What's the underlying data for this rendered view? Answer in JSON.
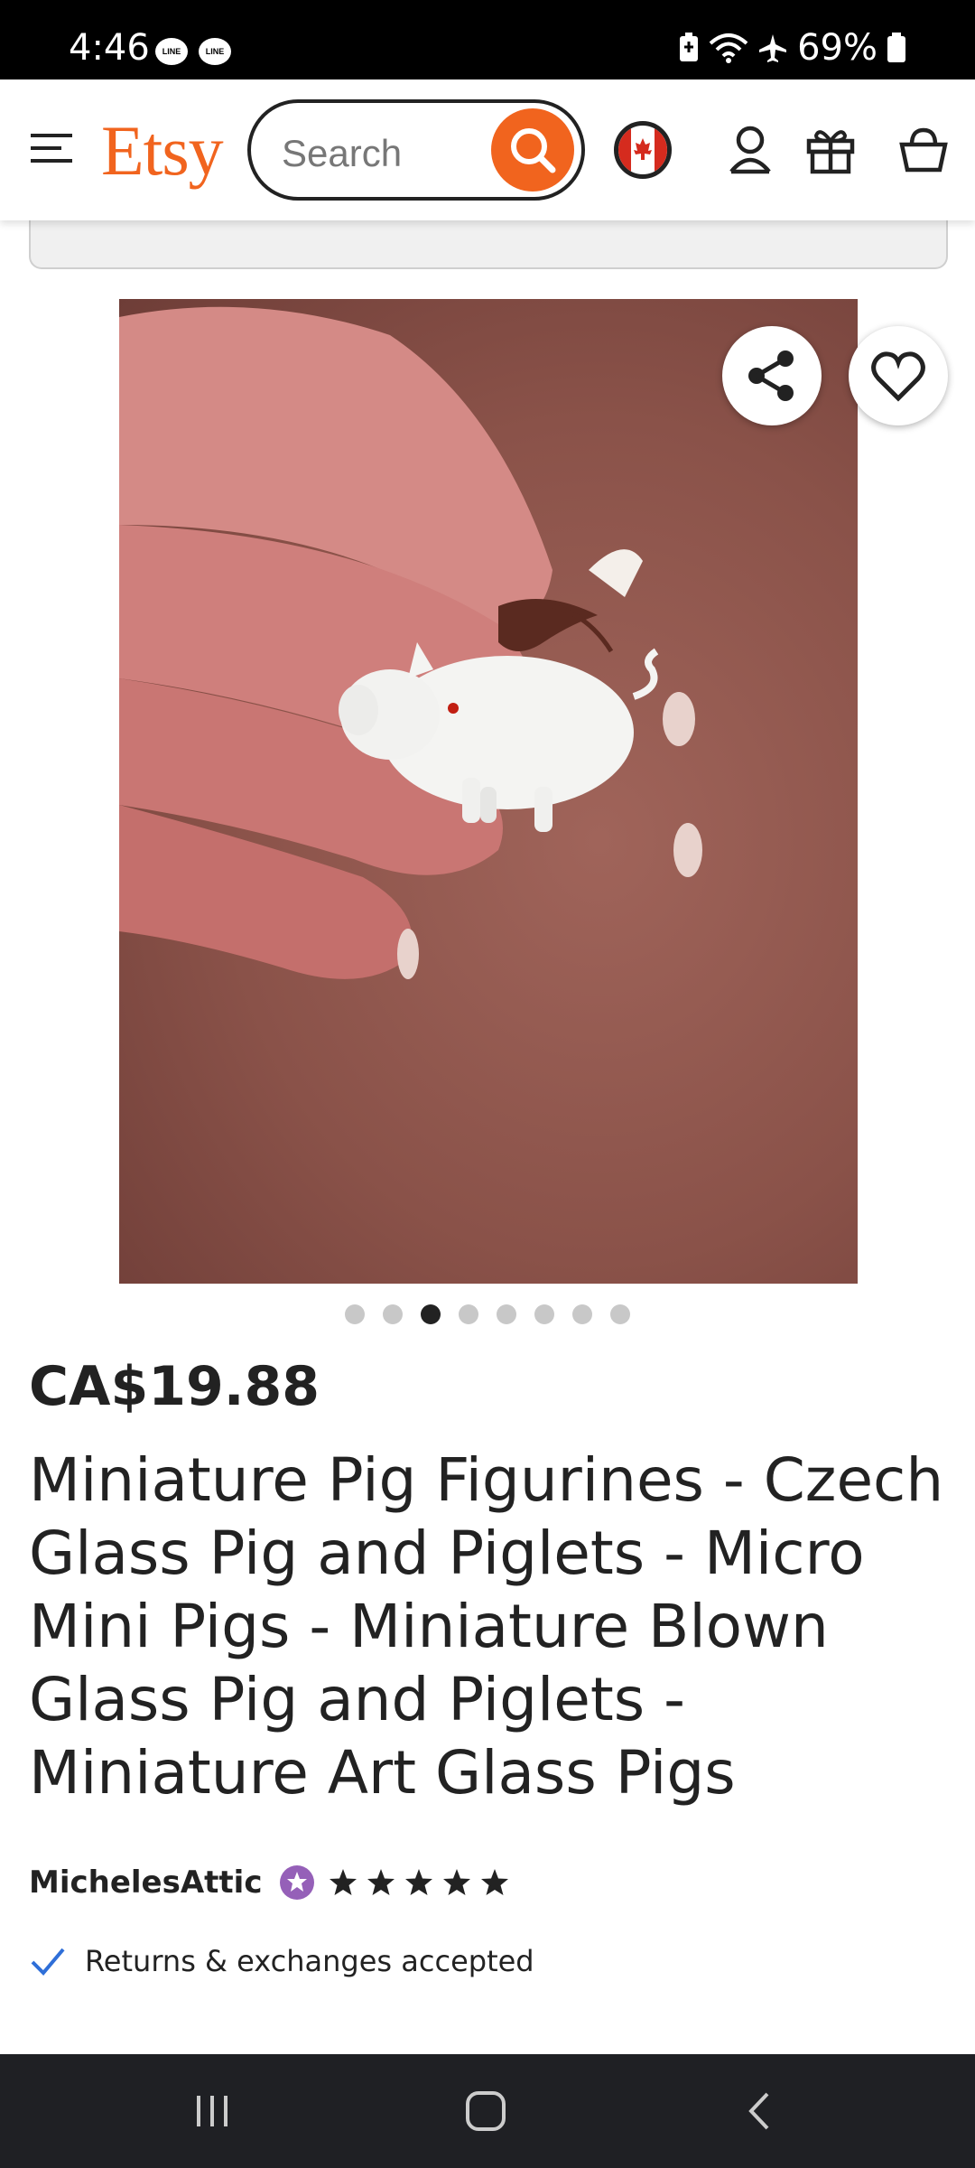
{
  "status_bar": {
    "time": "4:46",
    "notification_icons": [
      "line-icon",
      "line-icon"
    ],
    "line_badge_text": "LINE",
    "battery_percent": "69%",
    "icons": [
      "battery-saver-icon",
      "wifi-icon",
      "airplane-icon",
      "battery-icon"
    ]
  },
  "header": {
    "logo": "Etsy",
    "search_placeholder": "Search",
    "icons": [
      "menu-icon",
      "search-icon",
      "canada-flag-icon",
      "account-icon",
      "gift-icon",
      "cart-icon"
    ]
  },
  "colors": {
    "brand": "#F1641E",
    "text": "#222222",
    "star_seller": "#9560B8",
    "check": "#2F6FD8"
  },
  "carousel": {
    "total": 8,
    "active_index": 3,
    "overlay_icons": [
      "share-icon",
      "heart-icon"
    ]
  },
  "product": {
    "price": "CA$19.88",
    "title": "Miniature Pig Figurines - Czech Glass Pig and Piglets - Micro Mini Pigs - Miniature Blown Glass Pig and Piglets - Miniature Art Glass Pigs",
    "seller": "MichelesAttic",
    "rating_stars": 5,
    "returns": "Returns & exchanges accepted"
  },
  "nav_bar": {
    "icons": [
      "recent-apps-icon",
      "home-icon",
      "back-icon"
    ]
  }
}
